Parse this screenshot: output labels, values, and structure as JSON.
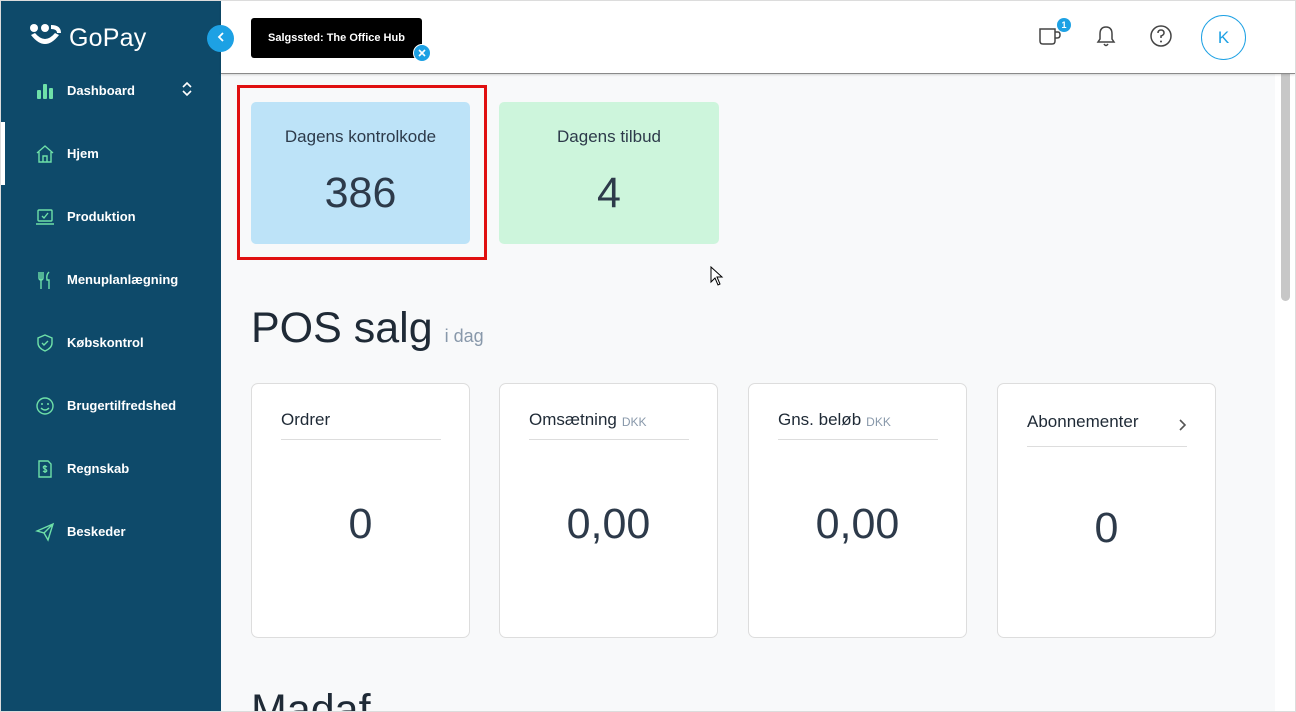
{
  "brand": {
    "name": "GoPay",
    "accent": "#1da1e4",
    "sidebar_bg": "#0e4a6a",
    "nav_icon_color": "#6ee0a8"
  },
  "sidebar": {
    "items": [
      {
        "label": "Dashboard",
        "icon": "bar-chart-icon"
      },
      {
        "label": "Hjem",
        "icon": "home-icon"
      },
      {
        "label": "Produktion",
        "icon": "production-icon"
      },
      {
        "label": "Menuplanlægning",
        "icon": "fork-knife-icon"
      },
      {
        "label": "Købskontrol",
        "icon": "shield-check-icon"
      },
      {
        "label": "Brugertilfredshed",
        "icon": "smiley-icon"
      },
      {
        "label": "Regnskab",
        "icon": "invoice-icon"
      },
      {
        "label": "Beskeder",
        "icon": "send-icon"
      }
    ]
  },
  "topbar": {
    "sales_point_chip": "Salgssted: The Office Hub",
    "notification_count": "1",
    "avatar_initial": "K"
  },
  "kpis": {
    "control_code": {
      "label": "Dagens kontrolkode",
      "value": "386",
      "bg": "#bde3f8"
    },
    "offers": {
      "label": "Dagens tilbud",
      "value": "4",
      "bg": "#cdf5dc"
    }
  },
  "pos": {
    "title": "POS salg",
    "subtitle": "i dag",
    "cards": [
      {
        "title": "Ordrer",
        "unit": "",
        "value": "0"
      },
      {
        "title": "Omsætning",
        "unit": "DKK",
        "value": "0,00"
      },
      {
        "title": "Gns. beløb",
        "unit": "DKK",
        "value": "0,00"
      },
      {
        "title": "Abonnementer",
        "unit": "",
        "value": "0"
      }
    ]
  },
  "next_section_title": "Madaf..."
}
